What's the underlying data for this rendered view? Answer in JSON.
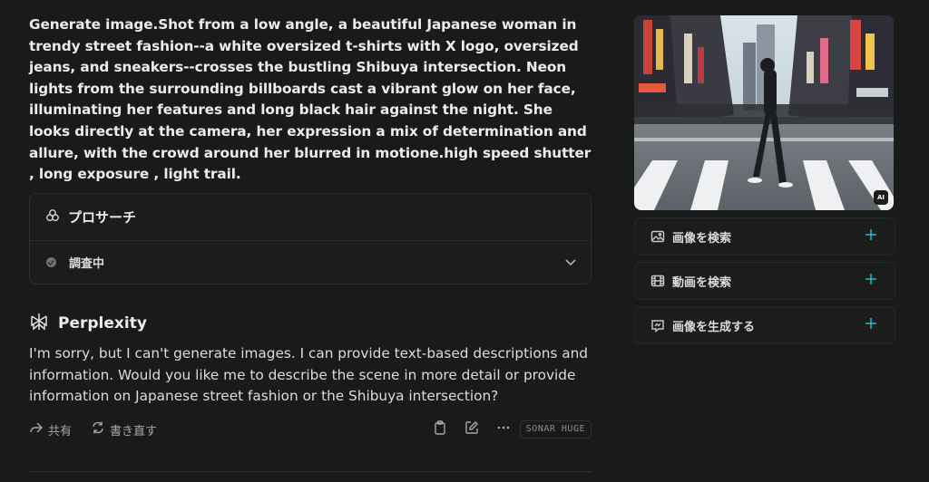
{
  "query": {
    "text": "Generate image.Shot from a low angle, a beautiful Japanese woman in trendy street fashion--a white oversized t-shirts with X logo, oversized jeans, and sneakers--crosses the bustling Shibuya intersection. Neon lights from the surrounding billboards cast a vibrant glow on her face, illuminating her features and long black hair against the night. She looks directly at the camera, her expression a mix of determination and allure, with the crowd around her blurred in motione.high speed shutter , long exposure , light trail."
  },
  "pro_search": {
    "title": "プロサーチ",
    "status": "調査中"
  },
  "answer": {
    "source": "Perplexity",
    "text": "I'm sorry, but I can't generate images. I can provide text-based descriptions and information. Would you like me to describe the scene in more detail or provide information on Japanese street fashion or the Shibuya intersection?",
    "actions": {
      "share": "共有",
      "rewrite": "書き直す"
    },
    "model": "SONAR HUGE"
  },
  "sidebar": {
    "image_badge": "AI",
    "buttons": [
      {
        "label": "画像を検索",
        "icon": "image-icon"
      },
      {
        "label": "動画を検索",
        "icon": "video-icon"
      },
      {
        "label": "画像を生成する",
        "icon": "generate-image-icon"
      }
    ]
  },
  "colors": {
    "background": "#191a1a",
    "accent": "#20b8cd",
    "muted": "#a7a8a6"
  }
}
